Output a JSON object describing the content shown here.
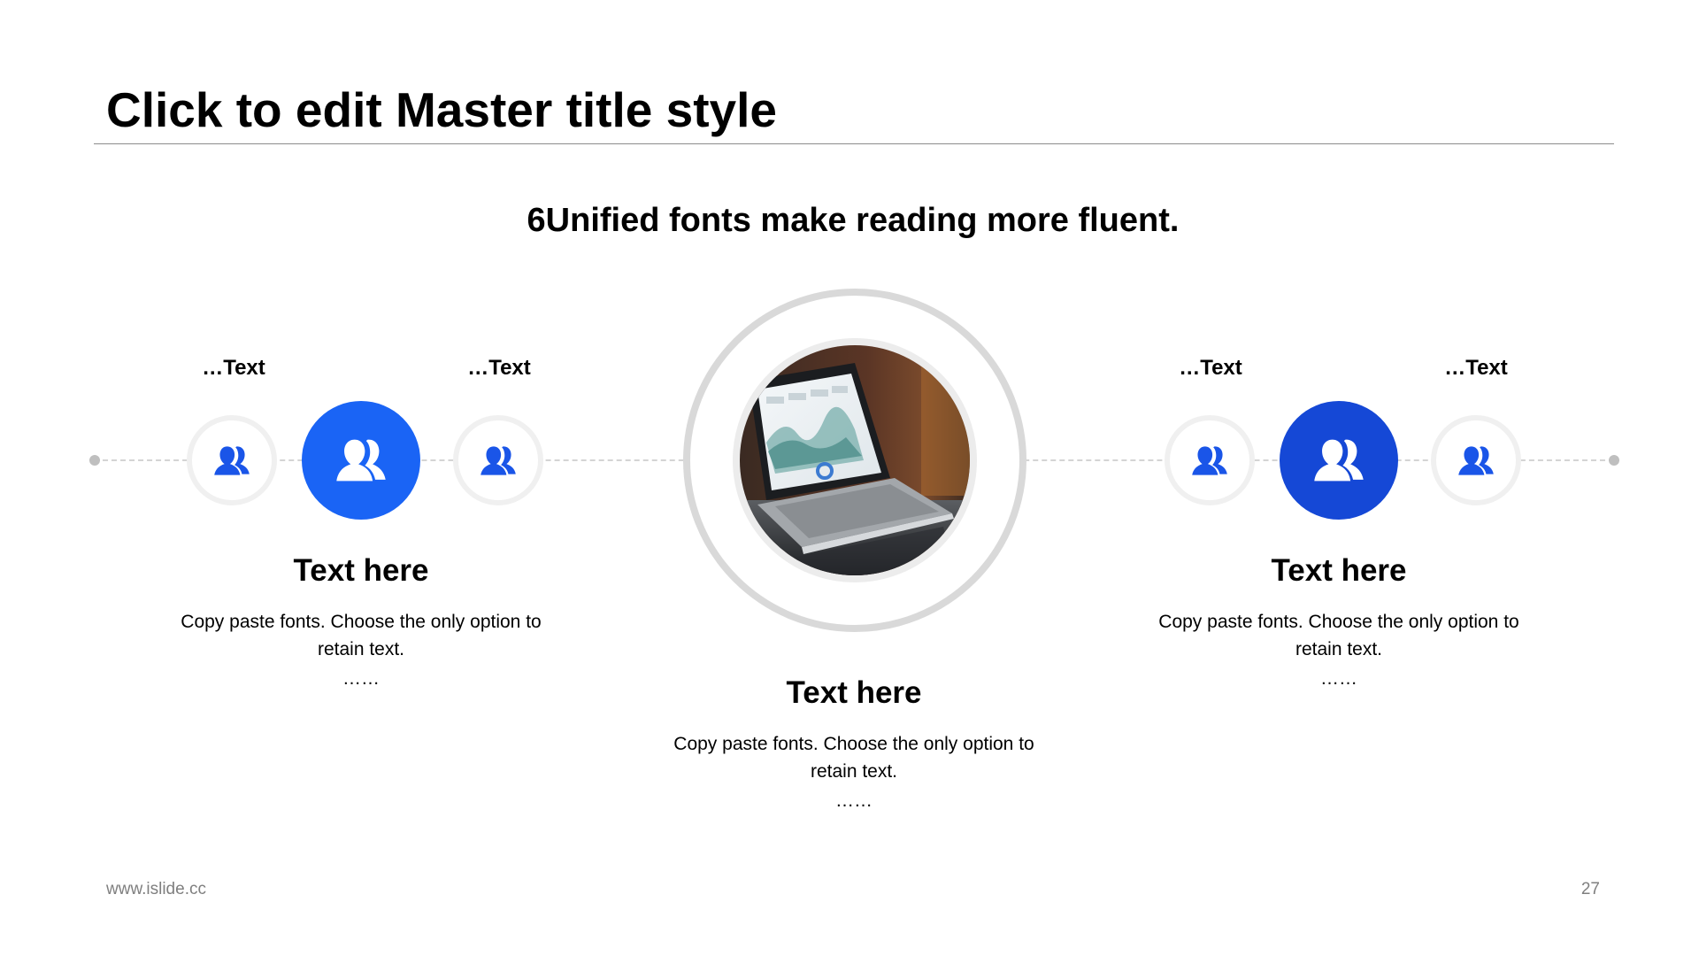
{
  "slide": {
    "title": "Click to edit Master title style",
    "subtitle": "6Unified fonts make reading more fluent."
  },
  "groups": {
    "left": {
      "dots_label_left": "…Text",
      "dots_label_right": "…Text",
      "heading": "Text here",
      "body": "Copy paste fonts. Choose the only option to retain text.",
      "ellipsis": "……",
      "accent_color": "#1a64f5"
    },
    "center": {
      "heading": "Text here",
      "body": "Copy paste fonts. Choose the only option to retain text.",
      "ellipsis": "……"
    },
    "right": {
      "dots_label_left": "…Text",
      "dots_label_right": "…Text",
      "heading": "Text here",
      "body": "Copy paste fonts. Choose the only option to retain text.",
      "ellipsis": "……",
      "accent_color": "#1548d6"
    }
  },
  "icons": {
    "small": "user-group-icon",
    "large": "user-group-icon",
    "center_image": "laptop-dashboard-photo"
  },
  "colors": {
    "icon_blue": "#1a55e8",
    "ring_gray": "#d9d9d9",
    "footer_gray": "#7f7f7f"
  },
  "footer": {
    "url": "www.islide.cc",
    "page_number": "27"
  }
}
